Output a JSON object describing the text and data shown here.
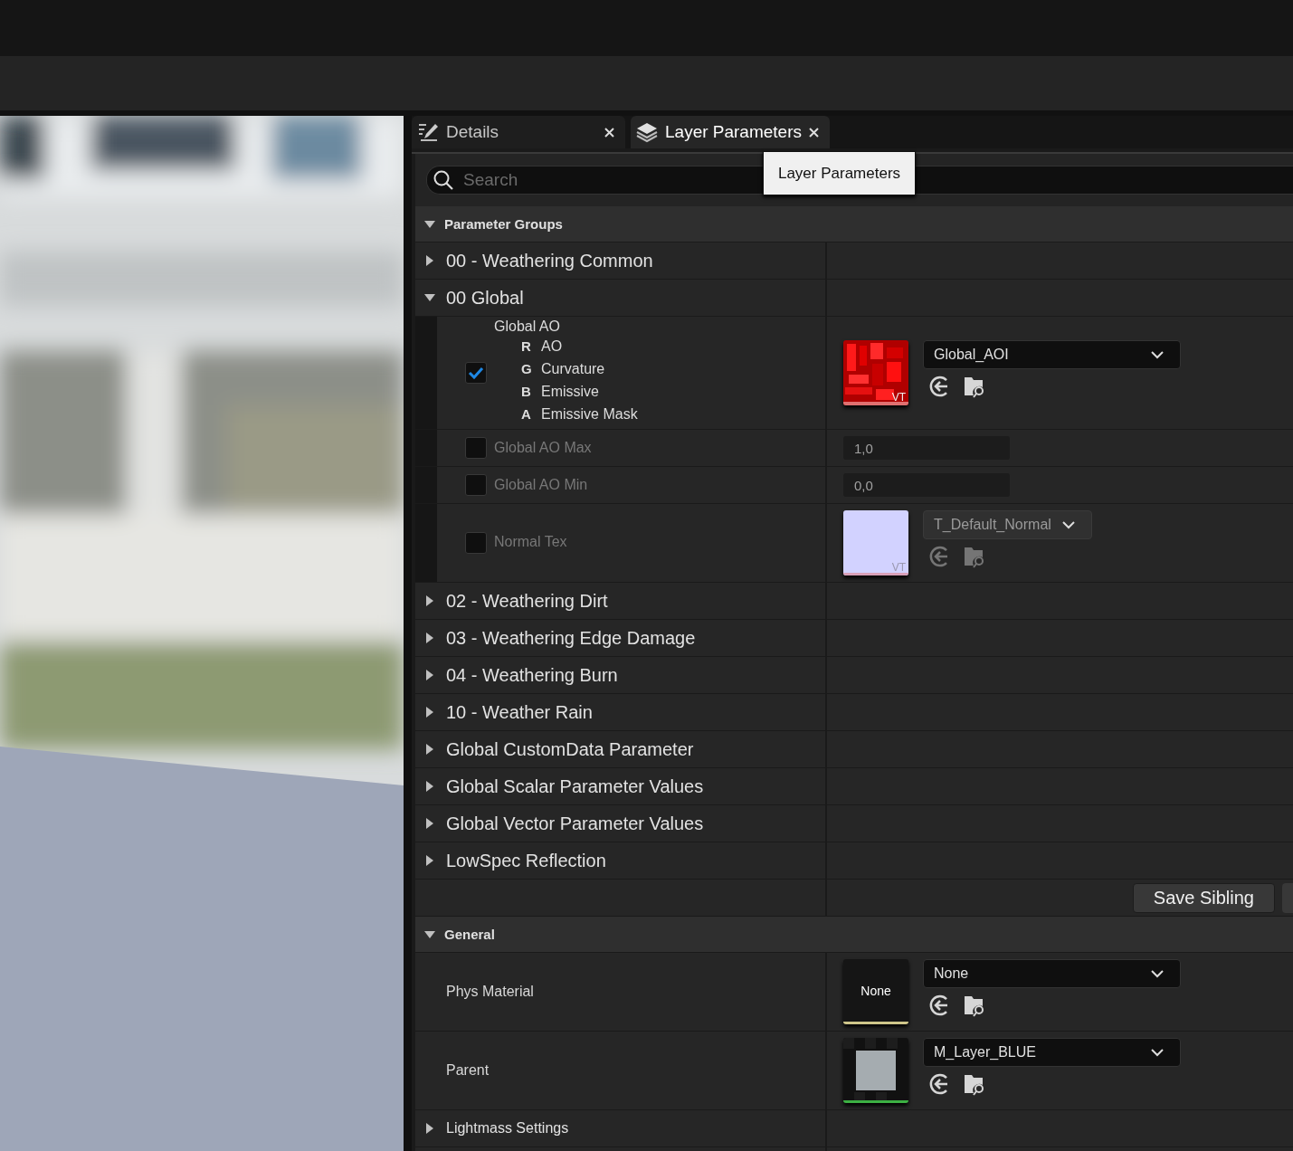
{
  "tabs": [
    {
      "kind": "details",
      "label": "Details",
      "selected": false
    },
    {
      "kind": "layers",
      "label": "Layer Parameters",
      "selected": true
    }
  ],
  "tooltip": "Layer Parameters",
  "search": {
    "placeholder": "Search"
  },
  "sections": [
    {
      "kind": "parameter-groups",
      "title": "Parameter Groups",
      "expanded": true,
      "groups": [
        {
          "label": "00 - Weathering Common",
          "expanded": false
        },
        {
          "label": "00 Global",
          "expanded": true,
          "params": [
            {
              "kind": "texture",
              "label": "Global AO",
              "checked": true,
              "channels": [
                {
                  "letter": "R",
                  "name": "AO"
                },
                {
                  "letter": "G",
                  "name": "Curvature"
                },
                {
                  "letter": "B",
                  "name": "Emissive"
                },
                {
                  "letter": "A",
                  "name": "Emissive Mask"
                }
              ],
              "thumbnail": {
                "kind": "red-pattern",
                "badge": "VT"
              },
              "asset": "Global_AOI"
            },
            {
              "kind": "number",
              "label": "Global AO Max",
              "checked": false,
              "value": "1,0"
            },
            {
              "kind": "number",
              "label": "Global AO Min",
              "checked": false,
              "value": "0,0"
            },
            {
              "kind": "texture",
              "label": "Normal Tex",
              "checked": false,
              "thumbnail": {
                "kind": "lavender",
                "badge": "VT"
              },
              "asset": "T_Default_Normal"
            }
          ]
        },
        {
          "label": "02 - Weathering Dirt",
          "expanded": false
        },
        {
          "label": "03 - Weathering Edge Damage",
          "expanded": false
        },
        {
          "label": "04 - Weathering Burn",
          "expanded": false
        },
        {
          "label": "10 - Weather Rain",
          "expanded": false
        },
        {
          "label": "Global CustomData Parameter",
          "expanded": false
        },
        {
          "label": "Global Scalar Parameter Values",
          "expanded": false
        },
        {
          "label": "Global Vector Parameter Values",
          "expanded": false
        },
        {
          "label": "LowSpec Reflection",
          "expanded": false
        }
      ],
      "footer_button": "Save Sibling"
    },
    {
      "kind": "properties",
      "title": "General",
      "expanded": true,
      "properties": [
        {
          "label": "Phys Material",
          "thumbnail": {
            "kind": "empty",
            "text": "None"
          },
          "asset": "None"
        },
        {
          "label": "Parent",
          "thumbnail": {
            "kind": "material"
          },
          "asset": "M_Layer_BLUE"
        }
      ],
      "groups": [
        {
          "label": "Lightmass Settings",
          "expanded": false
        }
      ]
    }
  ]
}
